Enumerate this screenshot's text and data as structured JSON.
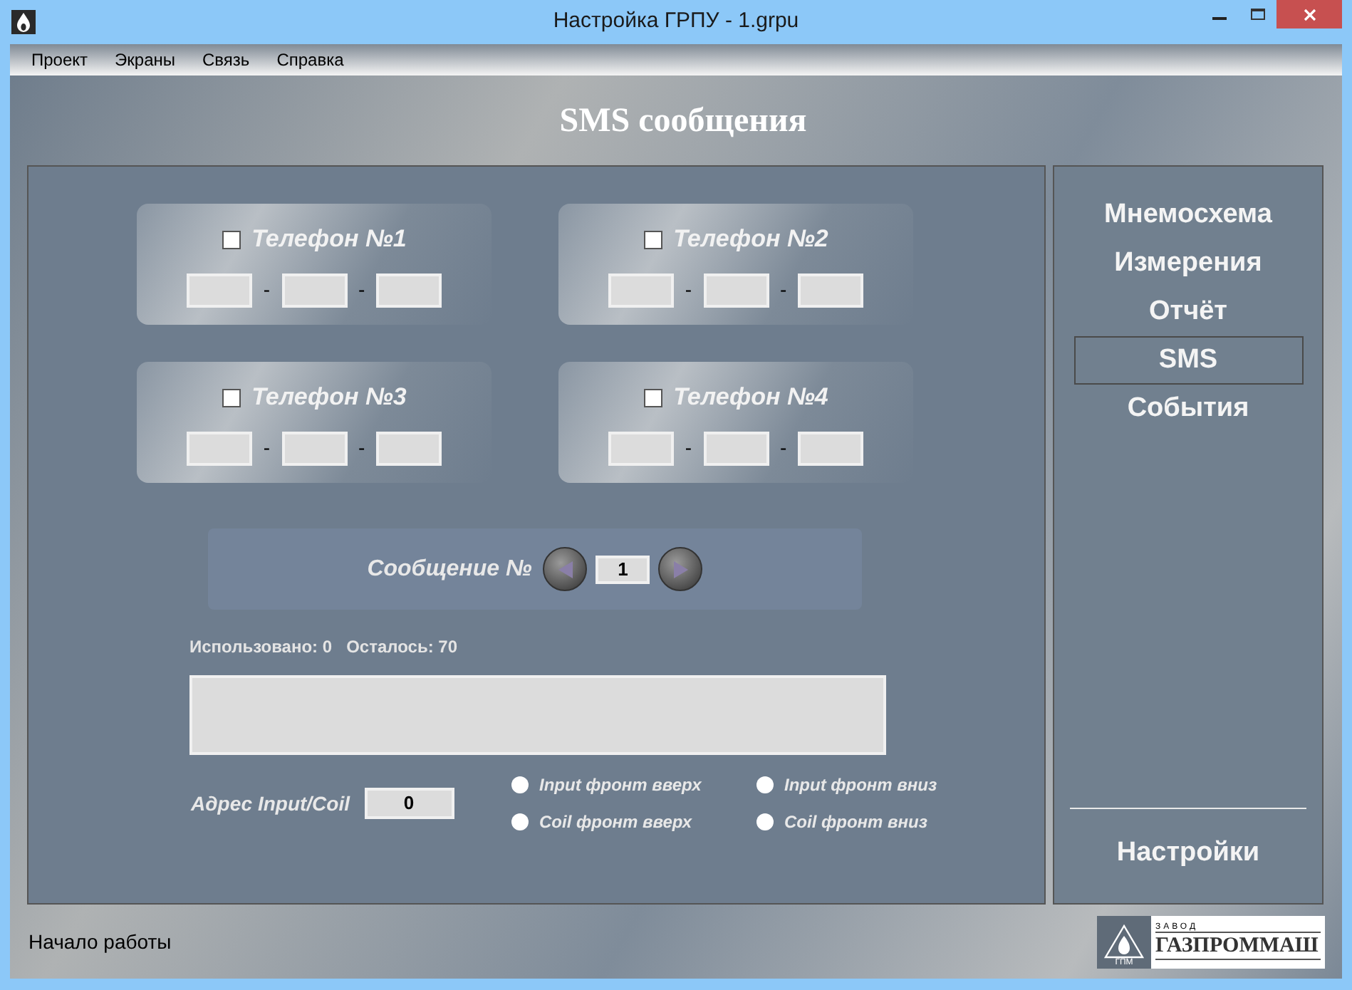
{
  "window": {
    "title": "Настройка ГРПУ - 1.grpu"
  },
  "menu": [
    "Проект",
    "Экраны",
    "Связь",
    "Справка"
  ],
  "heading": "SMS сообщения",
  "phones": [
    {
      "label": "Телефон №1",
      "checked": false,
      "separators": [
        "-",
        "-"
      ]
    },
    {
      "label": "Телефон №2",
      "checked": false,
      "separators": [
        "-",
        "-"
      ]
    },
    {
      "label": "Телефон №3",
      "checked": false,
      "separators": [
        "-",
        "-"
      ]
    },
    {
      "label": "Телефон №4",
      "checked": false,
      "separators": [
        "-",
        "-"
      ]
    }
  ],
  "message": {
    "label": "Сообщение №",
    "number": "1"
  },
  "counters": [
    {
      "label": "Использовано:",
      "value": "0"
    },
    {
      "label": "Осталось:",
      "value": "70"
    }
  ],
  "address": {
    "label": "Адрес Input/Coil",
    "value": "0"
  },
  "modes": [
    {
      "label": "Input фронт вверх",
      "selected": false
    },
    {
      "label": "Input фронт вниз",
      "selected": false
    },
    {
      "label": "Coil фронт вверх",
      "selected": false
    },
    {
      "label": "Coil фронт вниз",
      "selected": false
    }
  ],
  "nav": [
    {
      "label": "Мнемосхема",
      "selected": false
    },
    {
      "label": "Измерения",
      "selected": false
    },
    {
      "label": "Отчёт",
      "selected": false
    },
    {
      "label": "SMS",
      "selected": true
    },
    {
      "label": "События",
      "selected": false
    }
  ],
  "settings": "Настройки",
  "status": "Начало работы",
  "logo": {
    "top": "ЗАВОД",
    "name": "ГАЗПРОММАШ",
    "mark": "ГПМ"
  }
}
